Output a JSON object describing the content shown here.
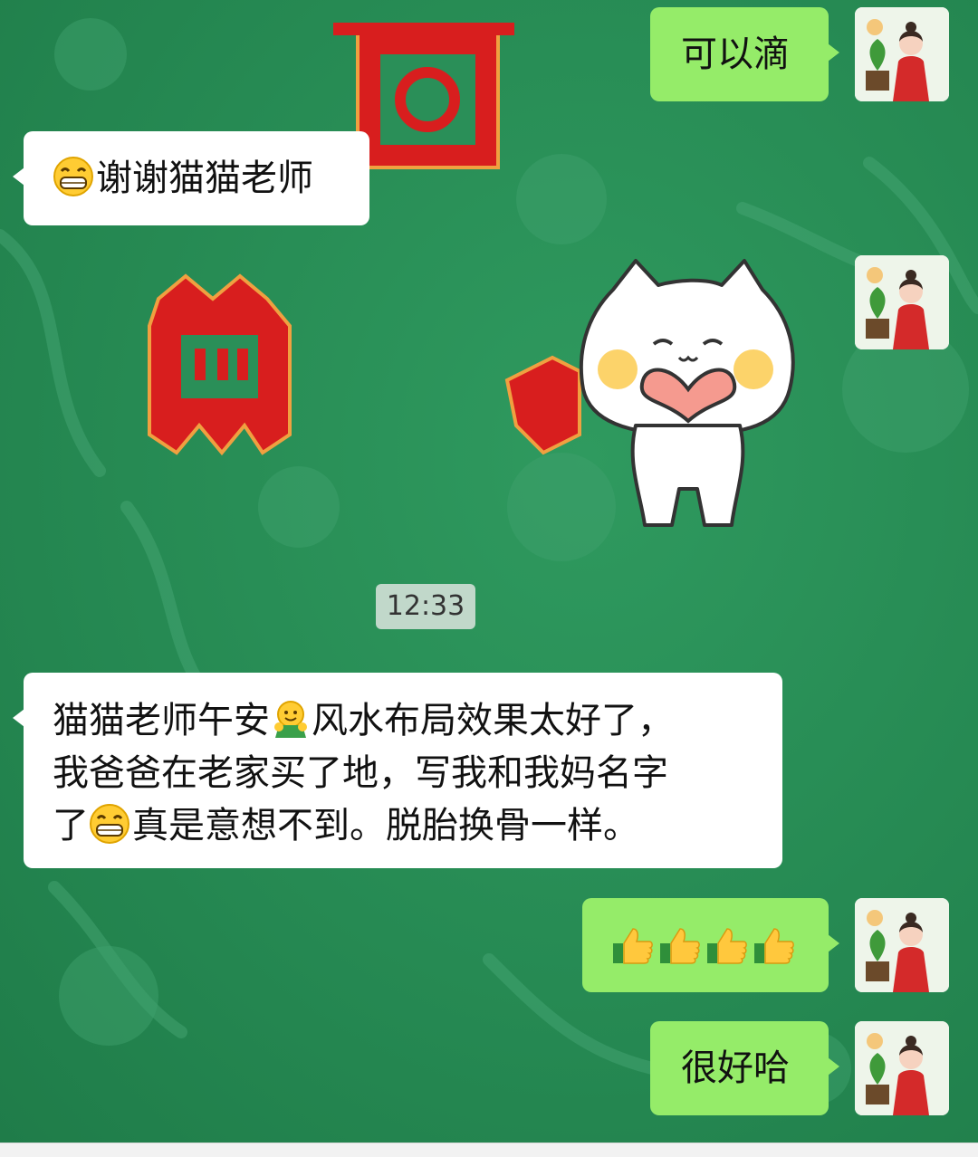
{
  "chat": {
    "messages": [
      {
        "side": "out",
        "text": "可以滴"
      },
      {
        "side": "in",
        "emoji": "grin-emoji",
        "text": "谢谢猫猫老师"
      },
      {
        "side": "out",
        "type": "sticker",
        "sticker": "white-cat-holding-heart"
      },
      {
        "side": "in",
        "type": "timestamp",
        "text": "12:33"
      },
      {
        "side": "in",
        "line1_a": "猫猫老师午安",
        "line1_b": "风水布局效果太好了，",
        "line2": "我爸爸在老家买了地，写我和我妈名字",
        "line3_a": "了",
        "line3_b": "真是意想不到。脱胎换骨一样。"
      },
      {
        "side": "out",
        "type": "emoji-row",
        "emoji": "thumbs-up",
        "count": 4
      },
      {
        "side": "out",
        "text": "很好哈"
      }
    ]
  },
  "colors": {
    "background": "#2a8f58",
    "outgoing_bubble": "#95ec69",
    "incoming_bubble": "#ffffff"
  }
}
